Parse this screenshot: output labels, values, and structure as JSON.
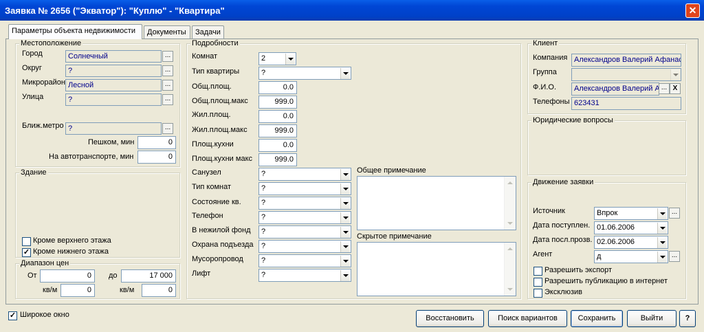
{
  "window": {
    "title": "Заявка № 2656 (\"Экватор\"): \"Куплю\" - \"Квартира\"",
    "close": "✕"
  },
  "tabs": [
    "Параметры объекта недвижимости",
    "Документы",
    "Задачи"
  ],
  "location": {
    "title": "Местоположение",
    "city_label": "Город",
    "city": "Солнечный",
    "district_label": "Округ",
    "district": "?",
    "microdistrict_label": "Микрорайон",
    "microdistrict": "Лесной",
    "street_label": "Улица",
    "street": "?",
    "metro_label": "Ближ.метро",
    "metro": "?",
    "walk_label": "Пешком, мин",
    "walk": "0",
    "transport_label": "На автотранспорте, мин",
    "transport": "0"
  },
  "building": {
    "title": "Здание",
    "not_top_label": "Кроме верхнего этажа",
    "not_top_checked": false,
    "not_bottom_label": "Кроме нижнего этажа",
    "not_bottom_checked": true
  },
  "price": {
    "title": "Диапазон цен",
    "from_label": "От",
    "from": "0",
    "to_label": "до",
    "to": "17 000",
    "sqm_label1": "кв/м",
    "sqm_from": "0",
    "sqm_label2": "кв/м",
    "sqm_to": "0"
  },
  "details": {
    "title": "Подробности",
    "rooms_label": "Комнат",
    "rooms": "2",
    "apt_type_label": "Тип квартиры",
    "apt_type": "?",
    "total_area_label": "Общ.площ.",
    "total_area": "0.0",
    "total_area_max_label": "Общ.площ.макс",
    "total_area_max": "999.0",
    "living_area_label": "Жил.площ.",
    "living_area": "0.0",
    "living_area_max_label": "Жил.площ.макс",
    "living_area_max": "999.0",
    "kitchen_label": "Площ.кухни",
    "kitchen": "0.0",
    "kitchen_max_label": "Площ.кухни макс",
    "kitchen_max": "999.0",
    "bathroom_label": "Санузел",
    "bathroom": "?",
    "room_type_label": "Тип комнат",
    "room_type": "?",
    "condition_label": "Состояние кв.",
    "condition": "?",
    "phone_label": "Телефон",
    "phone": "?",
    "nonres_label": "В нежилой фонд",
    "nonres": "?",
    "security_label": "Охрана подъезда",
    "security": "?",
    "garbage_label": "Мусоропровод",
    "garbage": "?",
    "lift_label": "Лифт",
    "lift": "?",
    "general_note_label": "Общее примечание",
    "hidden_note_label": "Скрытое примечание"
  },
  "client": {
    "title": "Клиент",
    "company_label": "Компания",
    "company": "Александров Валерий Афанас",
    "group_label": "Группа",
    "group": "",
    "name_label": "Ф.И.О.",
    "name": "Александров Валерий А",
    "clear": "X",
    "phones_label": "Телефоны",
    "phones": "623431"
  },
  "legal": {
    "title": "Юридические вопросы"
  },
  "movement": {
    "title": "Движение заявки",
    "source_label": "Источник",
    "source": "Впрок",
    "received_label": "Дата поступлен.",
    "received": "01.06.2006",
    "last_label": "Дата посл.прозв.",
    "last": "02.06.2006",
    "agent_label": "Агент",
    "agent": "д",
    "export_label": "Разрешить экспорт",
    "internet_label": "Разрешить публикацию в интернет",
    "exclusive_label": "Эксклюзив"
  },
  "footer": {
    "wide_label": "Широкое окно",
    "wide_checked": true,
    "restore": "Восстановить",
    "search": "Поиск вариантов",
    "save": "Сохранить",
    "exit": "Выйти",
    "help": "?"
  }
}
